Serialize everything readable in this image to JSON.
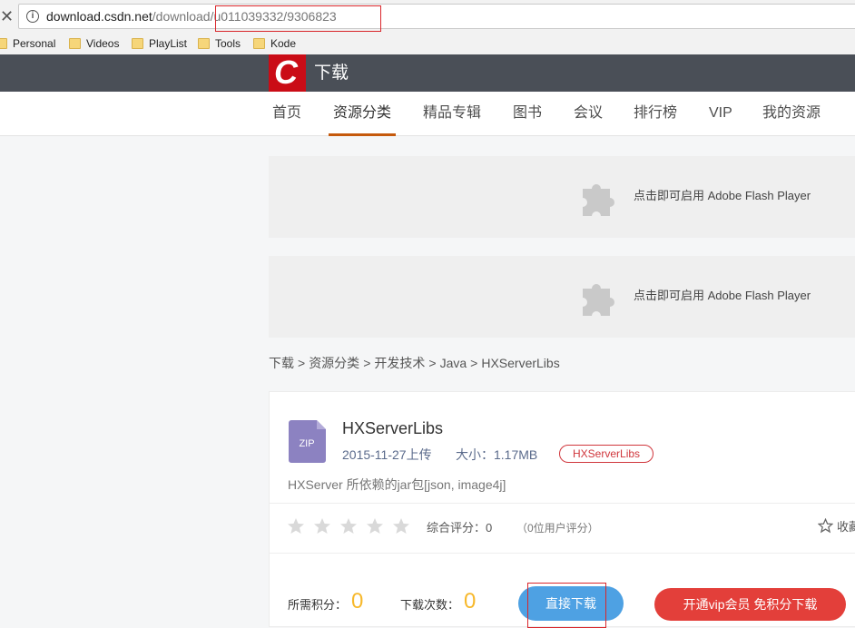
{
  "browser": {
    "close_glyph": "✕",
    "url_main": "download.csdn.net",
    "url_path": "/download/",
    "url_tail": "u011039332/9306823",
    "bookmarks": [
      "Personal",
      "Videos",
      "PlayList",
      "Tools",
      "Kode"
    ]
  },
  "header": {
    "logo_letter": "C",
    "title": "下载"
  },
  "nav": {
    "items": [
      "首页",
      "资源分类",
      "精品专辑",
      "图书",
      "会议",
      "排行榜",
      "VIP",
      "我的资源"
    ],
    "active_index": 1
  },
  "flash": {
    "text": "点击即可启用 Adobe Flash Player"
  },
  "breadcrumb": [
    "下载",
    "资源分类",
    "开发技术",
    "Java",
    "HXServerLibs"
  ],
  "breadcrumb_sep": ">",
  "resource": {
    "file_type": "ZIP",
    "title": "HXServerLibs",
    "date": "2015-11-27上传",
    "size": "大小：1.17MB",
    "tag": "HXServerLibs",
    "description": "HXServer 所依赖的jar包[json, image4j]",
    "rating_label": "综合评分：0",
    "rating_count": "（0位用户评分）",
    "stars_filled": 0,
    "stars_total": 5,
    "favorite": "收藏",
    "required_points_label": "所需积分：",
    "required_points": "0",
    "downloads_label": "下载次数：",
    "downloads": "0",
    "direct_download": "直接下载",
    "vip_download": "开通vip会员 免积分下载"
  },
  "colors": {
    "header_bg": "#4a4f57",
    "brand_red": "#ca0c16",
    "nav_underline": "#c5590c",
    "highlight_red": "#d9262b",
    "blue_button": "#4ea1e3",
    "red_button": "#e33f3a",
    "score_yellow": "#f7b82b"
  }
}
